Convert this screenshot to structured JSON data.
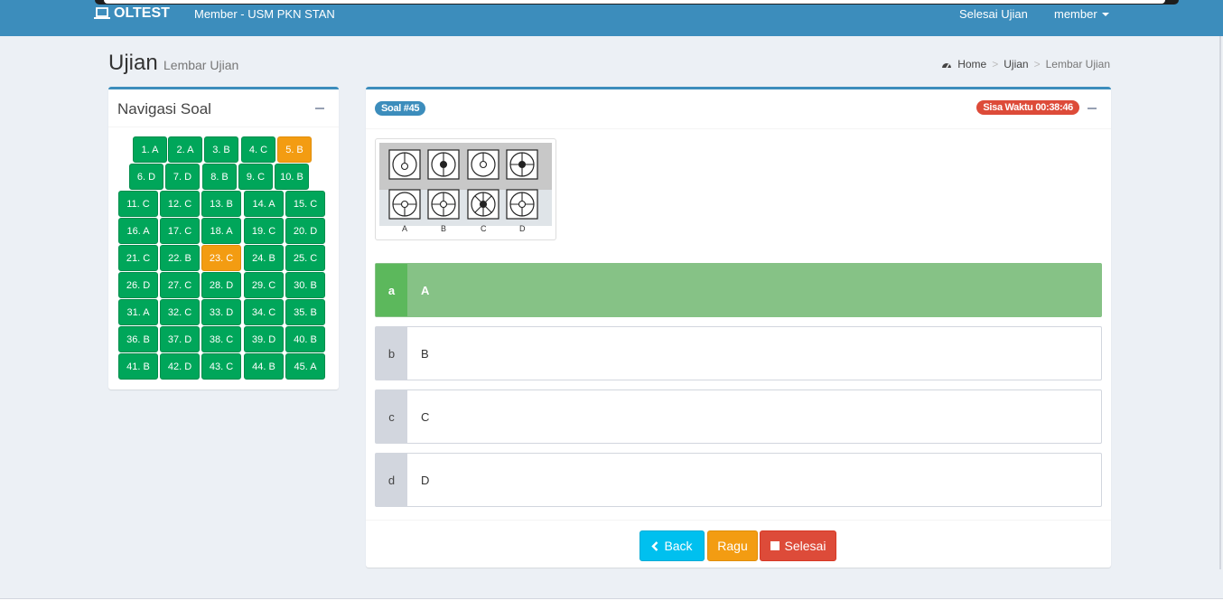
{
  "header": {
    "brand": "OLTEST",
    "subtitle": "Member - USM PKN STAN",
    "finish_link": "Selesai Ujian",
    "user_menu": "member",
    "color": "#3c8dbc"
  },
  "page": {
    "title": "Ujian",
    "subtitle": "Lembar Ujian"
  },
  "breadcrumb": {
    "items": [
      "Home",
      "Ujian",
      "Lembar Ujian"
    ],
    "separator": ">"
  },
  "nav_panel": {
    "title": "Navigasi Soal",
    "questions": [
      {
        "label": "1. A",
        "status": "answered"
      },
      {
        "label": "2. A",
        "status": "answered"
      },
      {
        "label": "3. B",
        "status": "answered"
      },
      {
        "label": "4. C",
        "status": "answered"
      },
      {
        "label": "5. B",
        "status": "ragu"
      },
      {
        "label": "6. D",
        "status": "answered"
      },
      {
        "label": "7. D",
        "status": "answered"
      },
      {
        "label": "8. B",
        "status": "answered"
      },
      {
        "label": "9. C",
        "status": "answered"
      },
      {
        "label": "10. B",
        "status": "answered"
      },
      {
        "label": "11. C",
        "status": "answered"
      },
      {
        "label": "12. C",
        "status": "answered"
      },
      {
        "label": "13. B",
        "status": "answered"
      },
      {
        "label": "14. A",
        "status": "answered"
      },
      {
        "label": "15. C",
        "status": "answered"
      },
      {
        "label": "16. A",
        "status": "answered"
      },
      {
        "label": "17. C",
        "status": "answered"
      },
      {
        "label": "18. A",
        "status": "answered"
      },
      {
        "label": "19. C",
        "status": "answered"
      },
      {
        "label": "20. D",
        "status": "answered"
      },
      {
        "label": "21. C",
        "status": "answered"
      },
      {
        "label": "22. B",
        "status": "answered"
      },
      {
        "label": "23. C",
        "status": "ragu"
      },
      {
        "label": "24. B",
        "status": "answered"
      },
      {
        "label": "25. C",
        "status": "answered"
      },
      {
        "label": "26. D",
        "status": "answered"
      },
      {
        "label": "27. C",
        "status": "answered"
      },
      {
        "label": "28. D",
        "status": "answered"
      },
      {
        "label": "29. C",
        "status": "answered"
      },
      {
        "label": "30. B",
        "status": "answered"
      },
      {
        "label": "31. A",
        "status": "answered"
      },
      {
        "label": "32. C",
        "status": "answered"
      },
      {
        "label": "33. D",
        "status": "answered"
      },
      {
        "label": "34. C",
        "status": "answered"
      },
      {
        "label": "35. B",
        "status": "answered"
      },
      {
        "label": "36. B",
        "status": "answered"
      },
      {
        "label": "37. D",
        "status": "answered"
      },
      {
        "label": "38. C",
        "status": "answered"
      },
      {
        "label": "39. D",
        "status": "answered"
      },
      {
        "label": "40. B",
        "status": "answered"
      },
      {
        "label": "41. B",
        "status": "answered"
      },
      {
        "label": "42. D",
        "status": "answered"
      },
      {
        "label": "43. C",
        "status": "answered"
      },
      {
        "label": "44. B",
        "status": "answered"
      },
      {
        "label": "45. A",
        "status": "answered"
      }
    ]
  },
  "question": {
    "badge": "Soal #45",
    "timer": "Sisa Waktu 00:38:46",
    "figure_labels": [
      "A",
      "B",
      "C",
      "D"
    ],
    "options": [
      {
        "letter": "a",
        "text": "A",
        "selected": true
      },
      {
        "letter": "b",
        "text": "B",
        "selected": false
      },
      {
        "letter": "c",
        "text": "C",
        "selected": false
      },
      {
        "letter": "d",
        "text": "D",
        "selected": false
      }
    ]
  },
  "buttons": {
    "back": "Back",
    "ragu": "Ragu",
    "selesai": "Selesai"
  },
  "colors": {
    "answered": "#00a65a",
    "ragu": "#f39c12",
    "danger": "#dd4b39",
    "info": "#00c0ef"
  }
}
